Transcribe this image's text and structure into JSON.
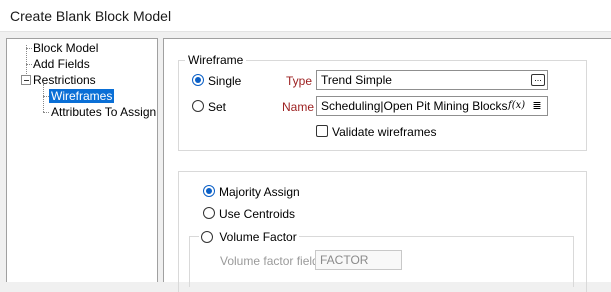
{
  "window": {
    "title": "Create Blank Block Model"
  },
  "tree": {
    "items": [
      {
        "label": "Block Model"
      },
      {
        "label": "Add Fields"
      },
      {
        "label": "Restrictions"
      },
      {
        "label": "Wireframes"
      },
      {
        "label": "Attributes To Assign"
      }
    ]
  },
  "wireframe": {
    "group_title": "Wireframe",
    "single_label": "Single",
    "set_label": "Set",
    "type_label": "Type",
    "type_value": "Trend Simple",
    "name_label": "Name",
    "name_value": "Scheduling|Open Pit Mining Blocks",
    "validate_label": "Validate wireframes",
    "function_glyph": "f(x)",
    "list_glyph": "≣",
    "browse_glyph": "..."
  },
  "assign": {
    "majority_label": "Majority Assign",
    "centroids_label": "Use Centroids",
    "volume_label": "Volume Factor",
    "volume_field_label": "Volume factor field",
    "volume_field_value": "FACTOR"
  },
  "colors": {
    "accent": "#0a5fc6",
    "selection": "#0a6fd6",
    "required_label": "#9c1f1f"
  }
}
